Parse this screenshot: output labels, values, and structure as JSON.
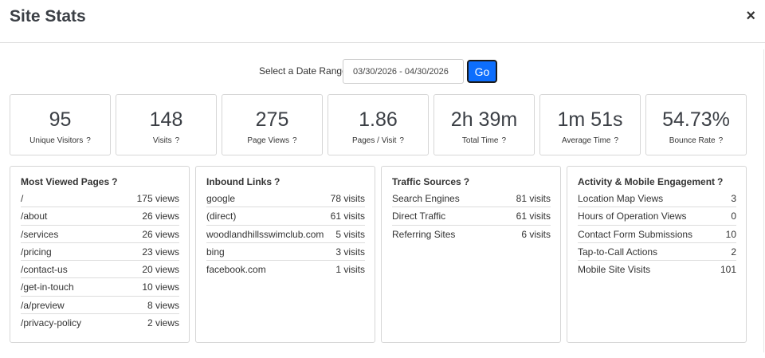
{
  "header": {
    "title": "Site Stats",
    "close_symbol": "×"
  },
  "date_range": {
    "label": "Select a Date Range",
    "value": "03/30/2026 - 04/30/2026",
    "go_label": "Go"
  },
  "help_symbol": "?",
  "stats": [
    {
      "value": "95",
      "label": "Unique Visitors"
    },
    {
      "value": "148",
      "label": "Visits"
    },
    {
      "value": "275",
      "label": "Page Views"
    },
    {
      "value": "1.86",
      "label": "Pages / Visit"
    },
    {
      "value": "2h 39m",
      "label": "Total Time"
    },
    {
      "value": "1m 51s",
      "label": "Average Time"
    },
    {
      "value": "54.73%",
      "label": "Bounce Rate"
    }
  ],
  "panels": [
    {
      "title": "Most Viewed Pages",
      "rows": [
        {
          "name": "/",
          "value": "175 views"
        },
        {
          "name": "/about",
          "value": "26 views"
        },
        {
          "name": "/services",
          "value": "26 views"
        },
        {
          "name": "/pricing",
          "value": "23 views"
        },
        {
          "name": "/contact-us",
          "value": "20 views"
        },
        {
          "name": "/get-in-touch",
          "value": "10 views"
        },
        {
          "name": "/a/preview",
          "value": "8 views"
        },
        {
          "name": "/privacy-policy",
          "value": "2 views"
        }
      ]
    },
    {
      "title": "Inbound Links",
      "rows": [
        {
          "name": "google",
          "value": "78 visits"
        },
        {
          "name": "(direct)",
          "value": "61 visits"
        },
        {
          "name": "woodlandhillsswimclub.com",
          "value": "5 visits"
        },
        {
          "name": "bing",
          "value": "3 visits"
        },
        {
          "name": "facebook.com",
          "value": "1 visits"
        }
      ]
    },
    {
      "title": "Traffic Sources",
      "rows": [
        {
          "name": "Search Engines",
          "value": "81 visits"
        },
        {
          "name": "Direct Traffic",
          "value": "61 visits"
        },
        {
          "name": "Referring Sites",
          "value": "6 visits"
        }
      ]
    },
    {
      "title": "Activity & Mobile Engagement",
      "rows": [
        {
          "name": "Location Map Views",
          "value": "3"
        },
        {
          "name": "Hours of Operation Views",
          "value": "0"
        },
        {
          "name": "Contact Form Submissions",
          "value": "10"
        },
        {
          "name": "Tap-to-Call Actions",
          "value": "2"
        },
        {
          "name": "Mobile Site Visits",
          "value": "101"
        }
      ]
    }
  ]
}
